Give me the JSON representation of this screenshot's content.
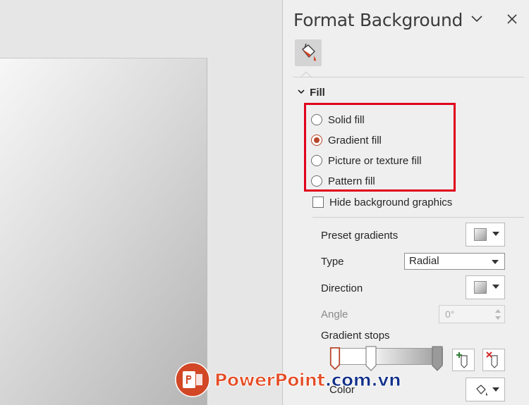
{
  "pane": {
    "title": "Format Background",
    "menu_icon": "chevron-down-icon",
    "close_icon": "close-icon"
  },
  "tabs": {
    "fill_icon": "paint-bucket-icon"
  },
  "fill_section": {
    "heading": "Fill",
    "options": [
      {
        "label": "Solid fill",
        "selected": false
      },
      {
        "label": "Gradient fill",
        "selected": true
      },
      {
        "label": "Picture or texture fill",
        "selected": false
      },
      {
        "label": "Pattern fill",
        "selected": false
      }
    ],
    "hide_background_label": "Hide background graphics",
    "hide_background_checked": false
  },
  "gradient": {
    "preset_label": "Preset gradients",
    "type_label": "Type",
    "type_value": "Radial",
    "direction_label": "Direction",
    "angle_label": "Angle",
    "angle_value": "0°",
    "stops_label": "Gradient stops",
    "stop_positions_percent": [
      0,
      40,
      100
    ],
    "add_stop_icon": "add-gradient-stop-icon",
    "remove_stop_icon": "remove-gradient-stop-icon",
    "color_label": "Color",
    "color_icon": "fill-color-icon"
  },
  "watermark": {
    "part1": "PowerPoint",
    "part2": ".com.vn"
  },
  "colors": {
    "accent": "#b7472a",
    "highlight_box": "#e0001b"
  }
}
